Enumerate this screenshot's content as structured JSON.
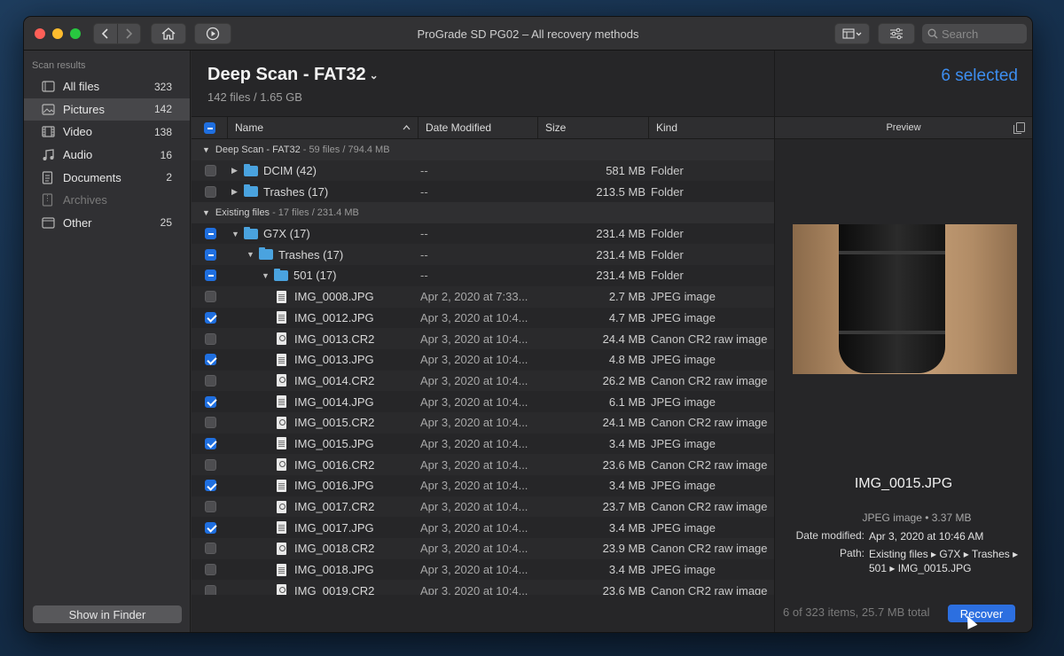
{
  "window": {
    "title": "ProGrade SD PG02 – All recovery methods"
  },
  "toolbar": {
    "search_placeholder": "Search"
  },
  "sidebar": {
    "header": "Scan results",
    "items": [
      {
        "label": "All files",
        "count": "323",
        "icon": "all-files-icon",
        "active": false,
        "disabled": false
      },
      {
        "label": "Pictures",
        "count": "142",
        "icon": "pictures-icon",
        "active": true,
        "disabled": false
      },
      {
        "label": "Video",
        "count": "138",
        "icon": "video-icon",
        "active": false,
        "disabled": false
      },
      {
        "label": "Audio",
        "count": "16",
        "icon": "audio-icon",
        "active": false,
        "disabled": false
      },
      {
        "label": "Documents",
        "count": "2",
        "icon": "documents-icon",
        "active": false,
        "disabled": false
      },
      {
        "label": "Archives",
        "count": "",
        "icon": "archives-icon",
        "active": false,
        "disabled": true
      },
      {
        "label": "Other",
        "count": "25",
        "icon": "other-icon",
        "active": false,
        "disabled": false
      }
    ],
    "show_in_finder": "Show in Finder"
  },
  "main": {
    "title": "Deep Scan - FAT32",
    "subtitle": "142 files / 1.65 GB",
    "selected": "6 selected",
    "columns": {
      "name": "Name",
      "date": "Date Modified",
      "size": "Size",
      "kind": "Kind"
    },
    "rows": [
      {
        "type": "group",
        "name": "Deep Scan - FAT32",
        "meta": " - 59 files / 794.4 MB"
      },
      {
        "type": "folder",
        "level": 0,
        "check": "off",
        "expand": "collapsed",
        "name": "DCIM (42)",
        "date": "--",
        "size": "581 MB",
        "kind": "Folder"
      },
      {
        "type": "folder",
        "level": 0,
        "check": "off",
        "expand": "collapsed",
        "name": "Trashes (17)",
        "date": "--",
        "size": "213.5 MB",
        "kind": "Folder"
      },
      {
        "type": "group",
        "name": "Existing files",
        "meta": " - 17 files / 231.4 MB"
      },
      {
        "type": "folder",
        "level": 0,
        "check": "mixed",
        "expand": "expanded",
        "name": "G7X (17)",
        "date": "--",
        "size": "231.4 MB",
        "kind": "Folder"
      },
      {
        "type": "folder",
        "level": 1,
        "check": "mixed",
        "expand": "expanded",
        "name": "Trashes (17)",
        "date": "--",
        "size": "231.4 MB",
        "kind": "Folder"
      },
      {
        "type": "folder",
        "level": 2,
        "check": "mixed",
        "expand": "expanded",
        "name": "501 (17)",
        "date": "--",
        "size": "231.4 MB",
        "kind": "Folder"
      },
      {
        "type": "file",
        "level": 3,
        "check": "off",
        "raw": false,
        "name": "IMG_0008.JPG",
        "date": "Apr 2, 2020 at 7:33...",
        "size": "2.7 MB",
        "kind": "JPEG image"
      },
      {
        "type": "file",
        "level": 3,
        "check": "on",
        "raw": false,
        "name": "IMG_0012.JPG",
        "date": "Apr 3, 2020 at 10:4...",
        "size": "4.7 MB",
        "kind": "JPEG image"
      },
      {
        "type": "file",
        "level": 3,
        "check": "off",
        "raw": true,
        "name": "IMG_0013.CR2",
        "date": "Apr 3, 2020 at 10:4...",
        "size": "24.4 MB",
        "kind": "Canon CR2 raw image"
      },
      {
        "type": "file",
        "level": 3,
        "check": "on",
        "raw": false,
        "name": "IMG_0013.JPG",
        "date": "Apr 3, 2020 at 10:4...",
        "size": "4.8 MB",
        "kind": "JPEG image"
      },
      {
        "type": "file",
        "level": 3,
        "check": "off",
        "raw": true,
        "name": "IMG_0014.CR2",
        "date": "Apr 3, 2020 at 10:4...",
        "size": "26.2 MB",
        "kind": "Canon CR2 raw image"
      },
      {
        "type": "file",
        "level": 3,
        "check": "on",
        "raw": false,
        "name": "IMG_0014.JPG",
        "date": "Apr 3, 2020 at 10:4...",
        "size": "6.1 MB",
        "kind": "JPEG image"
      },
      {
        "type": "file",
        "level": 3,
        "check": "off",
        "raw": true,
        "name": "IMG_0015.CR2",
        "date": "Apr 3, 2020 at 10:4...",
        "size": "24.1 MB",
        "kind": "Canon CR2 raw image"
      },
      {
        "type": "file",
        "level": 3,
        "check": "on",
        "raw": false,
        "name": "IMG_0015.JPG",
        "date": "Apr 3, 2020 at 10:4...",
        "size": "3.4 MB",
        "kind": "JPEG image"
      },
      {
        "type": "file",
        "level": 3,
        "check": "off",
        "raw": true,
        "name": "IMG_0016.CR2",
        "date": "Apr 3, 2020 at 10:4...",
        "size": "23.6 MB",
        "kind": "Canon CR2 raw image"
      },
      {
        "type": "file",
        "level": 3,
        "check": "on",
        "raw": false,
        "name": "IMG_0016.JPG",
        "date": "Apr 3, 2020 at 10:4...",
        "size": "3.4 MB",
        "kind": "JPEG image"
      },
      {
        "type": "file",
        "level": 3,
        "check": "off",
        "raw": true,
        "name": "IMG_0017.CR2",
        "date": "Apr 3, 2020 at 10:4...",
        "size": "23.7 MB",
        "kind": "Canon CR2 raw image"
      },
      {
        "type": "file",
        "level": 3,
        "check": "on",
        "raw": false,
        "name": "IMG_0017.JPG",
        "date": "Apr 3, 2020 at 10:4...",
        "size": "3.4 MB",
        "kind": "JPEG image"
      },
      {
        "type": "file",
        "level": 3,
        "check": "off",
        "raw": true,
        "name": "IMG_0018.CR2",
        "date": "Apr 3, 2020 at 10:4...",
        "size": "23.9 MB",
        "kind": "Canon CR2 raw image"
      },
      {
        "type": "file",
        "level": 3,
        "check": "off",
        "raw": false,
        "name": "IMG_0018.JPG",
        "date": "Apr 3, 2020 at 10:4...",
        "size": "3.4 MB",
        "kind": "JPEG image"
      },
      {
        "type": "file",
        "level": 3,
        "check": "off",
        "raw": true,
        "name": "IMG_0019.CR2",
        "date": "Apr 3, 2020 at 10:4...",
        "size": "23.6 MB",
        "kind": "Canon CR2 raw image"
      }
    ]
  },
  "preview": {
    "header": "Preview",
    "filename": "IMG_0015.JPG",
    "type_size": "JPEG image • 3.37 MB",
    "date_label": "Date modified:",
    "date_value": "Apr 3, 2020 at 10:46 AM",
    "path_label": "Path:",
    "path_value": "Existing files ▸ G7X ▸ Trashes ▸ 501 ▸ IMG_0015.JPG"
  },
  "footer": {
    "status": "6 of 323 items, 25.7 MB total",
    "recover": "Recover"
  },
  "colors": {
    "accent": "#1f6fe0",
    "selected_text": "#3d8ef0",
    "folder": "#4aa3df"
  }
}
